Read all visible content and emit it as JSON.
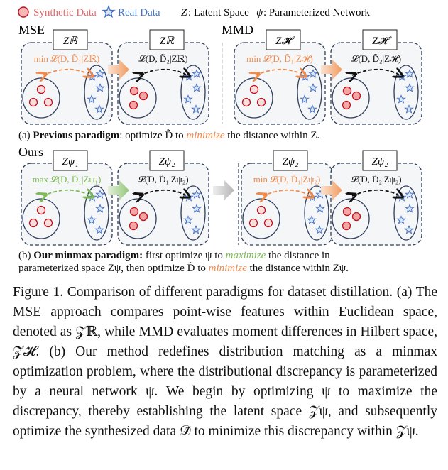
{
  "legend": {
    "synthetic_label": "Synthetic Data",
    "real_label": "Real Data",
    "latent_symbol": "Z",
    "latent_label": ": Latent Space",
    "network_symbol": "ψ",
    "network_label": ": Parameterized Network"
  },
  "colors": {
    "synthetic": "#e26a6a",
    "synthetic_stroke": "#c0101a",
    "real": "#4472c4",
    "orange": "#f08a4b",
    "green": "#7cba54",
    "box_border": "#2f3e5c"
  },
  "row_a": {
    "mse_label": "MSE",
    "mmd_label": "MMD",
    "panels": [
      {
        "space": "Z_R",
        "space_text": "Zℝ",
        "loss": "min 𝓛(D, D̃₁|Zℝ)",
        "loss_color": "orange"
      },
      {
        "space": "Z_R",
        "space_text": "Zℝ",
        "loss": "𝓛(D, D̃₂|Zℝ)",
        "loss_color": "black"
      },
      {
        "space": "Z_H",
        "space_text": "Z𝓗",
        "loss": "min 𝓛(D, D̃₁|Z𝓗)",
        "loss_color": "orange"
      },
      {
        "space": "Z_H",
        "space_text": "Z𝓗",
        "loss": "𝓛(D, D̃₂|Z𝓗)",
        "loss_color": "black"
      }
    ],
    "caption_prefix": "(a) ",
    "caption_bold": "Previous paradigm",
    "caption_mid": ": optimize D̃ to ",
    "caption_em": "minimize",
    "caption_end": " the distance within Z."
  },
  "row_b": {
    "ours_label": "Ours",
    "panels": [
      {
        "space_text": "Zψ₁",
        "loss": "max 𝓛(D, D̃₁|Zψ₁)",
        "loss_color": "green"
      },
      {
        "space_text": "Zψ₂",
        "loss": "𝓛(D, D̃₁|Zψ₂)",
        "loss_color": "black"
      },
      {
        "space_text": "Zψ₂",
        "loss": "min 𝓛(D, D̃₁|Zψ₂)",
        "loss_color": "orange"
      },
      {
        "space_text": "Zψ₂",
        "loss": "𝓛(D, D̃₂|Zψ₂)",
        "loss_color": "black"
      }
    ],
    "caption_prefix": "(b) ",
    "caption_bold": "Our minmax paradigm:",
    "caption_l1_a": " first optimize ψ to ",
    "caption_l1_em": "maximize",
    "caption_l1_b": " the distance in",
    "caption_l2_a": "parameterized space Zψ,  then optimize D̃ to ",
    "caption_l2_em": "minimize",
    "caption_l2_b": " the distance within Zψ."
  },
  "figure_caption": "Figure 1. Comparison of different paradigms for dataset distillation. (a) The MSE approach compares point-wise features within Euclidean space, denoted as 𝒵ℝ, while MMD evaluates moment differences in Hilbert space, 𝒵𝓗. (b) Our method redefines distribution matching as a minmax optimization problem, where the distributional discrepancy is parameterized by a neural network ψ. We begin by optimizing ψ to maximize the discrepancy, thereby establishing the latent space 𝒵ψ, and subsequently optimize the synthesized data 𝒟̃ to minimize this discrepancy within 𝒵ψ."
}
